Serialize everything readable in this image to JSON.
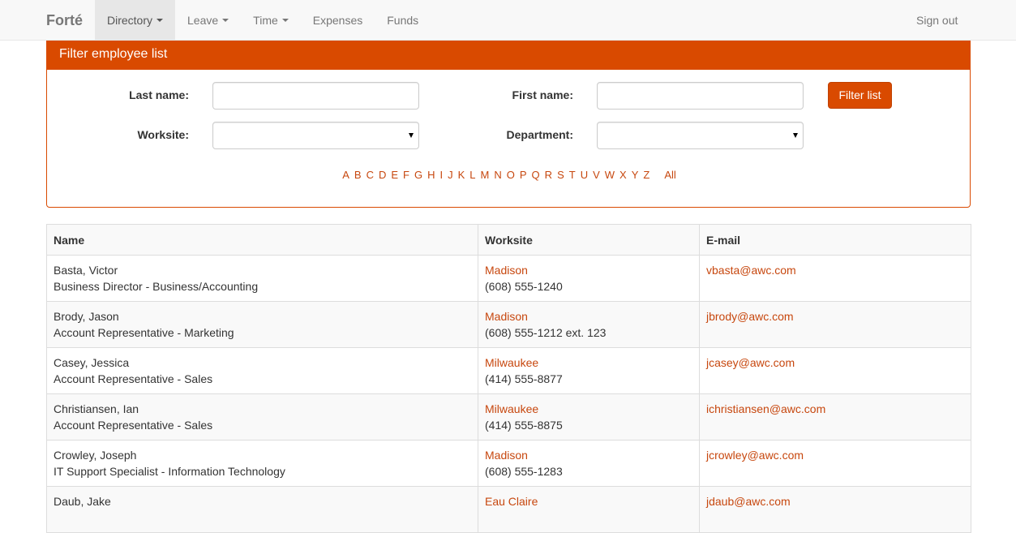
{
  "nav": {
    "brand": "Forté",
    "items": [
      {
        "label": "Directory",
        "dropdown": true,
        "active": true
      },
      {
        "label": "Leave",
        "dropdown": true,
        "active": false
      },
      {
        "label": "Time",
        "dropdown": true,
        "active": false
      },
      {
        "label": "Expenses",
        "dropdown": false,
        "active": false
      },
      {
        "label": "Funds",
        "dropdown": false,
        "active": false
      }
    ],
    "signout": "Sign out"
  },
  "filter": {
    "heading": "Filter employee list",
    "last_name_label": "Last name:",
    "first_name_label": "First name:",
    "worksite_label": "Worksite:",
    "department_label": "Department:",
    "last_name_value": "",
    "first_name_value": "",
    "worksite_value": "",
    "department_value": "",
    "button": "Filter list",
    "letters": [
      "A",
      "B",
      "C",
      "D",
      "E",
      "F",
      "G",
      "H",
      "I",
      "J",
      "K",
      "L",
      "M",
      "N",
      "O",
      "P",
      "Q",
      "R",
      "S",
      "T",
      "U",
      "V",
      "W",
      "X",
      "Y",
      "Z"
    ],
    "all_label": "All"
  },
  "table": {
    "headers": [
      "Name",
      "Worksite",
      "E-mail"
    ],
    "rows": [
      {
        "name": "Basta, Victor",
        "title": "Business Director - Business/Accounting",
        "worksite": "Madison",
        "phone": "(608) 555-1240",
        "email": "vbasta@awc.com"
      },
      {
        "name": "Brody, Jason",
        "title": "Account Representative - Marketing",
        "worksite": "Madison",
        "phone": "(608) 555-1212 ext. 123",
        "email": "jbrody@awc.com"
      },
      {
        "name": "Casey, Jessica",
        "title": "Account Representative - Sales",
        "worksite": "Milwaukee",
        "phone": "(414) 555-8877",
        "email": "jcasey@awc.com"
      },
      {
        "name": "Christiansen, Ian",
        "title": "Account Representative - Sales",
        "worksite": "Milwaukee",
        "phone": "(414) 555-8875",
        "email": "ichristiansen@awc.com"
      },
      {
        "name": "Crowley, Joseph",
        "title": "IT Support Specialist - Information Technology",
        "worksite": "Madison",
        "phone": "(608) 555-1283",
        "email": "jcrowley@awc.com"
      },
      {
        "name": "Daub, Jake",
        "title": "",
        "worksite": "Eau Claire",
        "phone": "",
        "email": "jdaub@awc.com"
      }
    ]
  }
}
